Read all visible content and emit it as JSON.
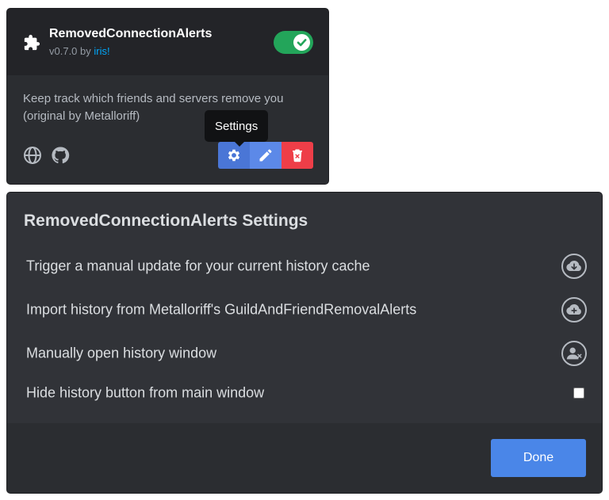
{
  "plugin": {
    "name": "RemovedConnectionAlerts",
    "version": "v0.7.0",
    "by": "by",
    "author": "iris!",
    "enabled": true,
    "description": "Keep track which friends and servers remove you (original by Metalloriff)",
    "tooltip": "Settings"
  },
  "colors": {
    "accent": "#5c89e8",
    "toggle_on": "#23a55a",
    "delete": "#ee3e48",
    "done": "#4a86e8"
  },
  "icons": {
    "plugin": "puzzle-icon",
    "website": "globe-icon",
    "source": "github-icon",
    "settings": "gear-icon",
    "edit": "pencil-icon",
    "delete": "trash-icon"
  },
  "settings": {
    "title": "RemovedConnectionAlerts Settings",
    "items": [
      {
        "label": "Trigger a manual update for your current history cache",
        "icon": "cloud-download-icon"
      },
      {
        "label": "Import history from Metalloriff's GuildAndFriendRemovalAlerts",
        "icon": "cloud-upload-icon"
      },
      {
        "label": "Manually open history window",
        "icon": "user-remove-icon"
      },
      {
        "label": "Hide history button from main window",
        "checked": false
      }
    ],
    "done_label": "Done"
  }
}
